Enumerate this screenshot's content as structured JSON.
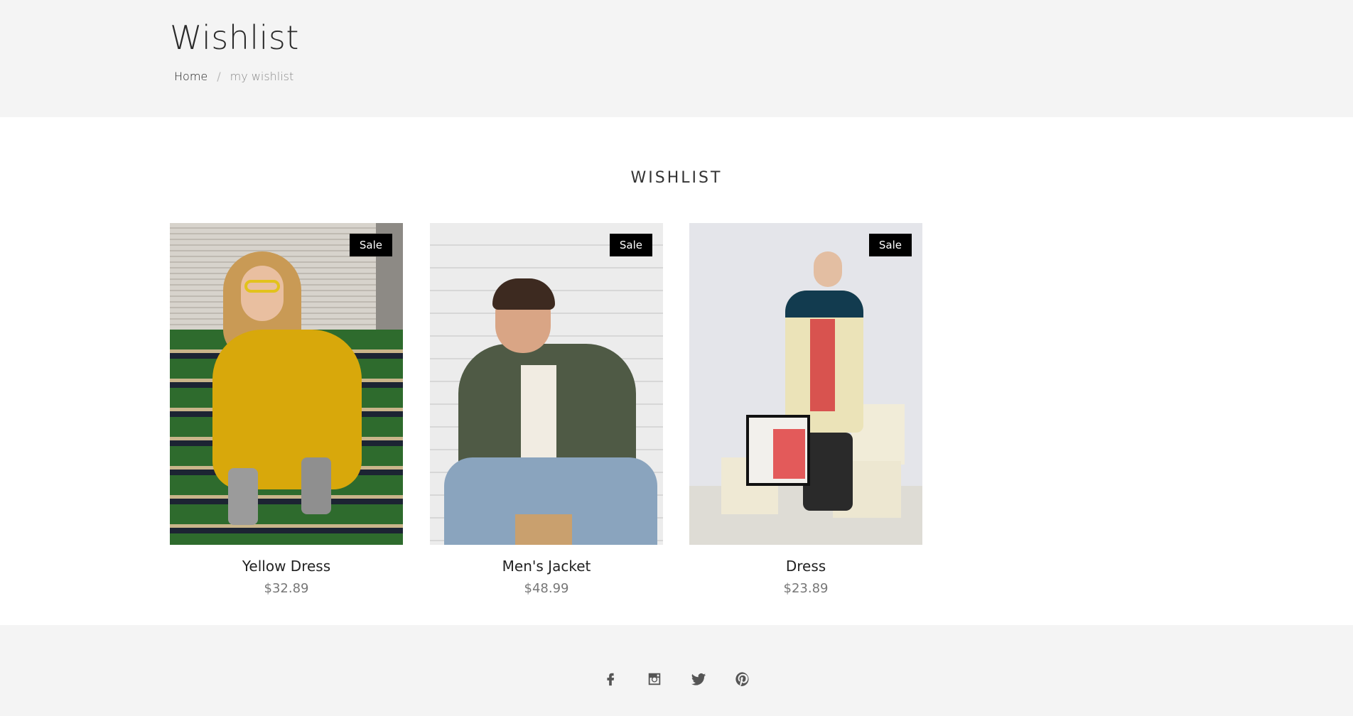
{
  "header": {
    "title": "Wishlist",
    "breadcrumb": {
      "home": "Home",
      "separator": "/",
      "current": "my wishlist"
    }
  },
  "section": {
    "title": "WISHLIST"
  },
  "products": [
    {
      "name": "Yellow Dress",
      "price": "$32.89",
      "badge": "Sale"
    },
    {
      "name": "Men's Jacket",
      "price": "$48.99",
      "badge": "Sale"
    },
    {
      "name": "Dress",
      "price": "$23.89",
      "badge": "Sale"
    }
  ],
  "footer": {
    "social_icons": [
      "facebook-icon",
      "instagram-icon",
      "twitter-icon",
      "pinterest-icon"
    ]
  },
  "colors": {
    "header_bg": "#f4f4f4",
    "badge_bg": "#000000",
    "price": "#777777"
  }
}
